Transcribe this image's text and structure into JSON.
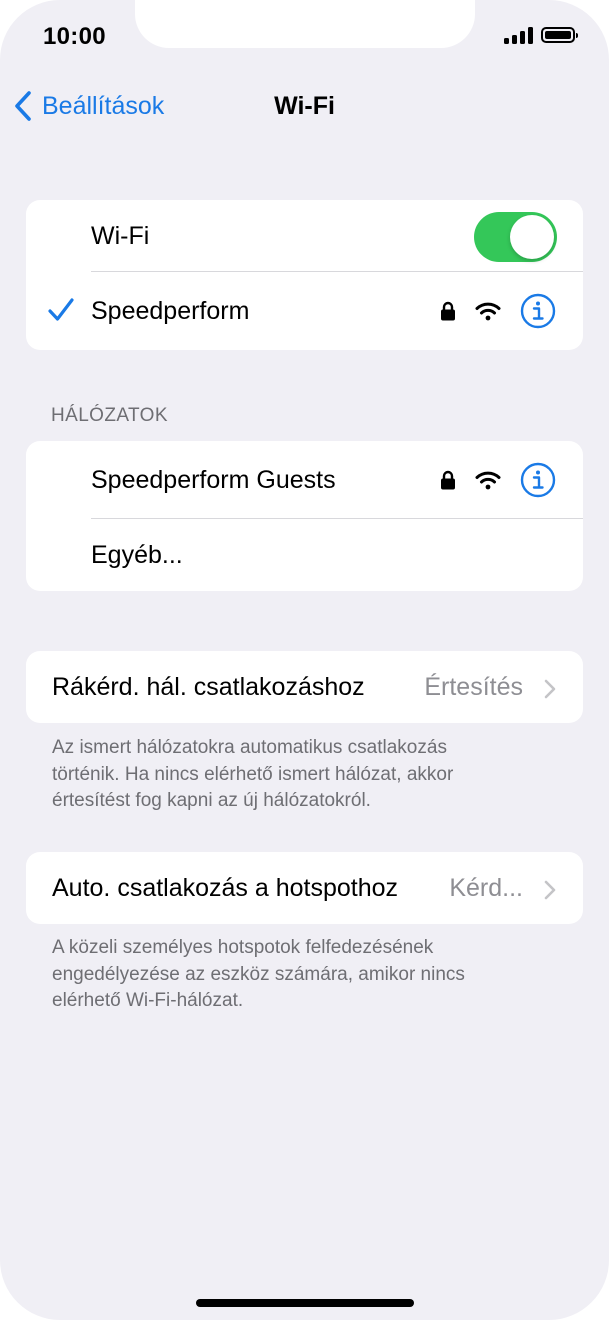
{
  "status_bar": {
    "time": "10:00"
  },
  "nav": {
    "back_label": "Beállítások",
    "title": "Wi-Fi"
  },
  "wifi_group": {
    "toggle_label": "Wi-Fi",
    "toggle_on": true,
    "connected_network": "Speedperform"
  },
  "networks": {
    "header": "HÁLÓZATOK",
    "items": [
      {
        "name": "Speedperform Guests"
      },
      {
        "name": "Egyéb..."
      }
    ]
  },
  "ask_to_join": {
    "label": "Rákérd. hál. csatlakozáshoz",
    "value": "Értesítés",
    "footnote_lines": [
      "Az ismert hálózatokra automatikus csatlakozás",
      "történik. Ha nincs elérhető ismert hálózat, akkor",
      "értesítést fog kapni az új hálózatokról."
    ]
  },
  "auto_join_hotspot": {
    "label": "Auto. csatlakozás a hotspothoz",
    "value": "Kérd...",
    "footnote_lines": [
      "A közeli személyes hotspotok felfedezésének",
      "engedélyezése az eszköz számára, amikor nincs",
      "elérhető Wi-Fi-hálózat."
    ]
  },
  "colors": {
    "accent": "#1a7ae6",
    "toggle_on": "#34c759",
    "background": "#f0eff5"
  }
}
